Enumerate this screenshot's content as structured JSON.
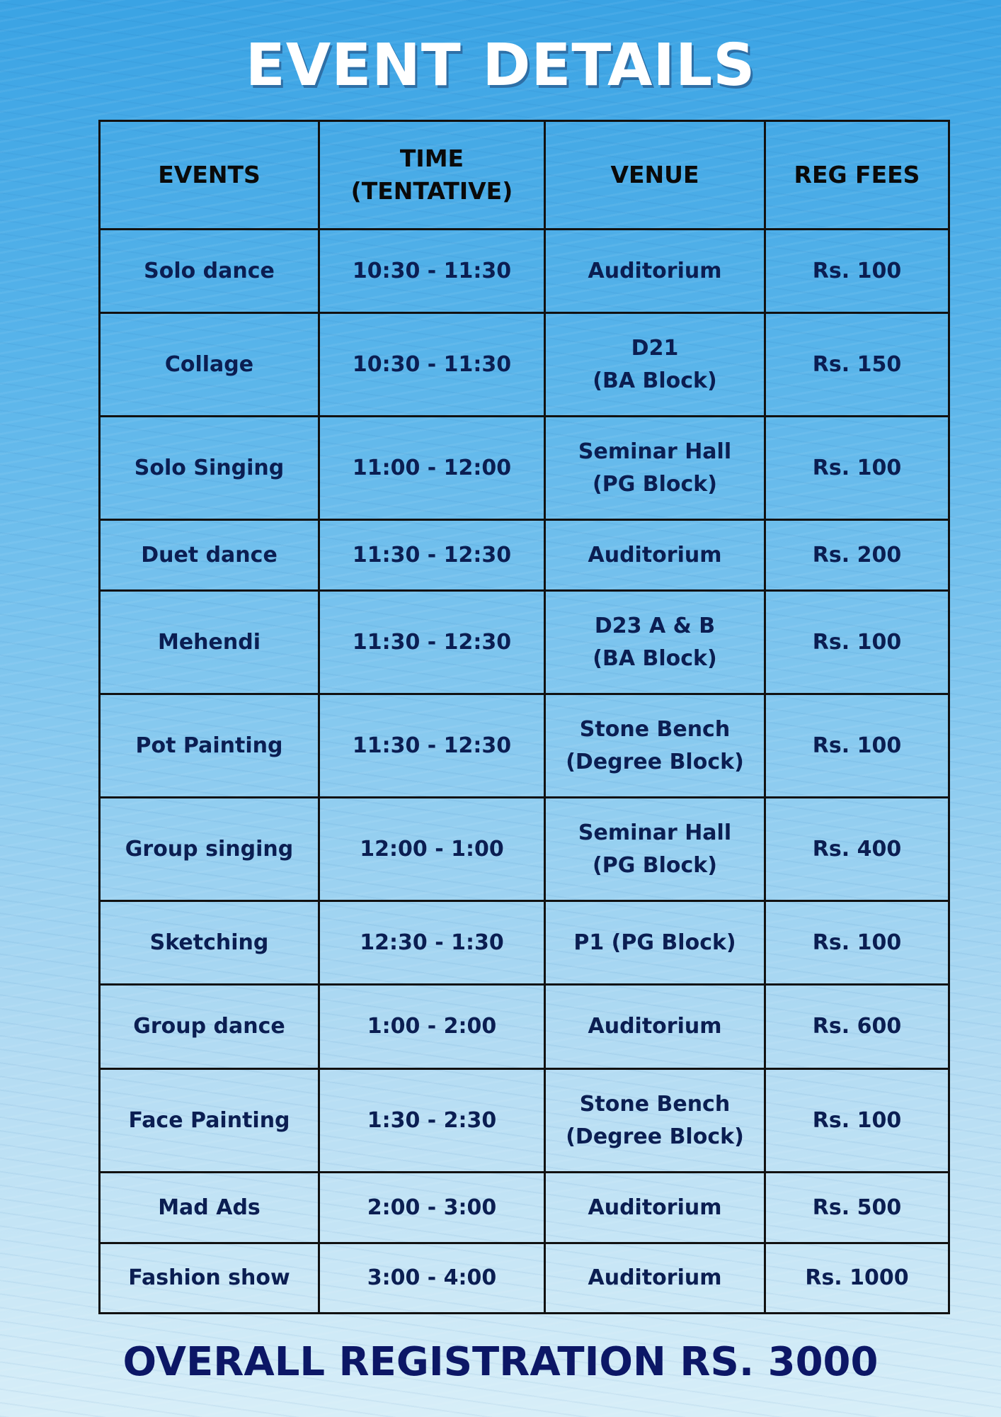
{
  "title": "EVENT DETAILS",
  "headers": {
    "events": "EVENTS",
    "time_line1": "TIME",
    "time_line2": "(TENTATIVE)",
    "venue": "VENUE",
    "fees": "REG FEES"
  },
  "rows": [
    {
      "event": "Solo dance",
      "time": "10:30 - 11:30",
      "venue1": "Auditorium",
      "venue2": "",
      "fee": "Rs. 100",
      "height": 118
    },
    {
      "event": "Collage",
      "time": "10:30 - 11:30",
      "venue1": "D21",
      "venue2": "(BA Block)",
      "fee": "Rs. 150"
    },
    {
      "event": "Solo Singing",
      "time": "11:00 - 12:00",
      "venue1": "Seminar Hall",
      "venue2": "(PG Block)",
      "fee": "Rs. 100"
    },
    {
      "event": "Duet dance",
      "time": "11:30 - 12:30",
      "venue1": "Auditorium",
      "venue2": "",
      "fee": "Rs. 200"
    },
    {
      "event": "Mehendi",
      "time": "11:30 - 12:30",
      "venue1": "D23 A & B",
      "venue2": "(BA Block)",
      "fee": "Rs. 100"
    },
    {
      "event": "Pot Painting",
      "time": "11:30 - 12:30",
      "venue1": "Stone Bench",
      "venue2": "(Degree Block)",
      "fee": "Rs. 100"
    },
    {
      "event": "Group singing",
      "time": "12:00 - 1:00",
      "venue1": "Seminar Hall",
      "venue2": "(PG Block)",
      "fee": "Rs. 400"
    },
    {
      "event": "Sketching",
      "time": "12:30 - 1:30",
      "venue1": "P1 (PG Block)",
      "venue2": "",
      "fee": "Rs. 100"
    },
    {
      "event": "Group dance",
      "time": "1:00 - 2:00",
      "venue1": "Auditorium",
      "venue2": "",
      "fee": "Rs. 600"
    },
    {
      "event": "Face Painting",
      "time": "1:30 - 2:30",
      "venue1": "Stone Bench",
      "venue2": "(Degree Block)",
      "fee": "Rs. 100"
    },
    {
      "event": "Mad Ads",
      "time": "2:00 - 3:00",
      "venue1": "Auditorium",
      "venue2": "",
      "fee": "Rs. 500"
    },
    {
      "event": "Fashion show",
      "time": "3:00 - 4:00",
      "venue1": "Auditorium",
      "venue2": "",
      "fee": "Rs. 1000"
    }
  ],
  "footer": "OVERALL REGISTRATION RS. 3000"
}
